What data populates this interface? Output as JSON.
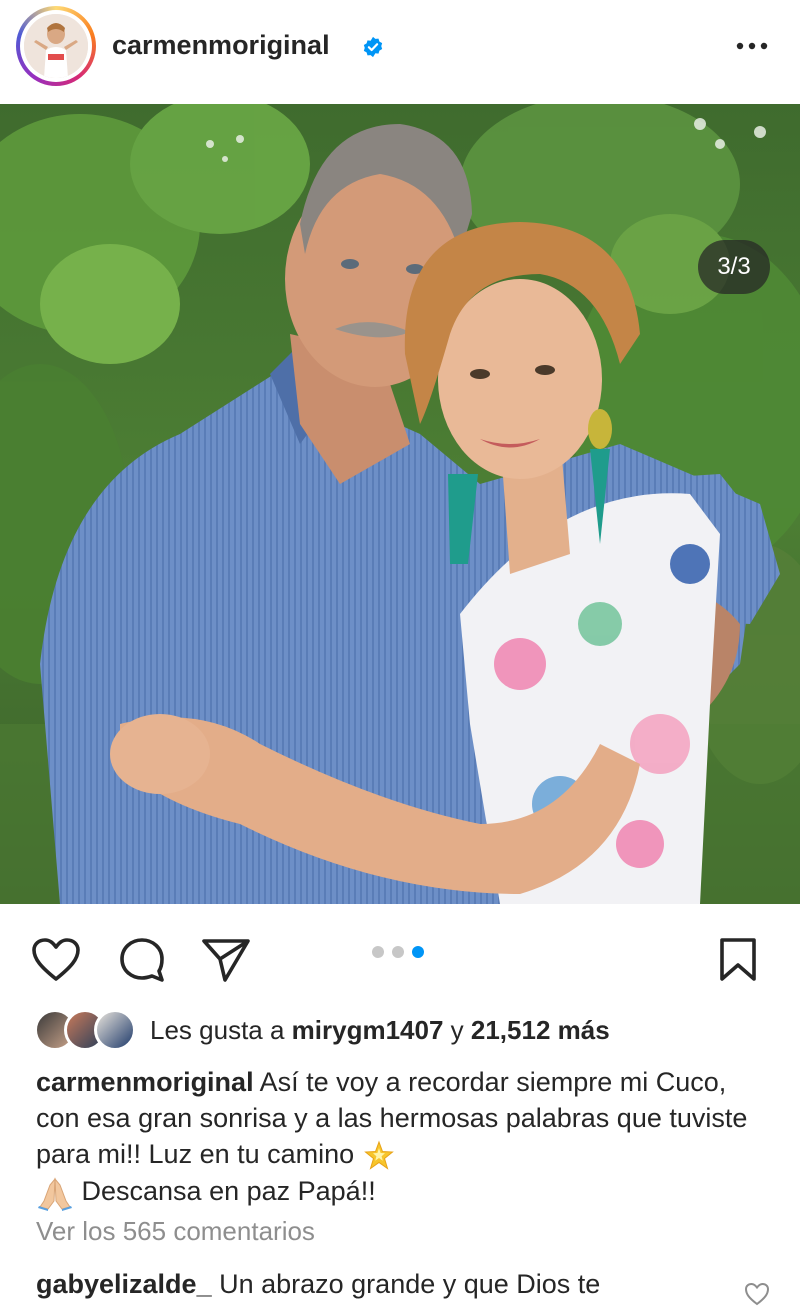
{
  "header": {
    "username": "carmenmoriginal",
    "verified": true,
    "more_icon": "more-horizontal-icon"
  },
  "photo": {
    "counter": "3/3",
    "slide_index": 3,
    "slide_total": 3
  },
  "actions": {
    "like_icon": "heart-icon",
    "comment_icon": "comment-icon",
    "share_icon": "send-icon",
    "save_icon": "bookmark-icon",
    "carousel_dots": 3,
    "active_dot": 3
  },
  "likes": {
    "prefix": "Les gusta a ",
    "user": "mirygm1407",
    "middle": " y ",
    "count": "21,512 más"
  },
  "caption": {
    "user": "carmenmoriginal",
    "text_1": " Así te voy a recordar siempre mi Cuco, con esa gran sonrisa y a las hermosas palabras  que tuviste para mi!! Luz en tu camino ",
    "text_2": " Descansa en paz Papá!!",
    "emoji_1": "glowing-star-emoji",
    "emoji_2": "folded-hands-emoji"
  },
  "comments": {
    "view_all": "Ver los 565 comentarios",
    "first_user": "gabyelizalde_",
    "first_text": " Un abrazo grande y que Dios te"
  },
  "colors": {
    "accent_blue": "#0095f6",
    "text": "#262626",
    "muted": "#8e8e8e"
  }
}
